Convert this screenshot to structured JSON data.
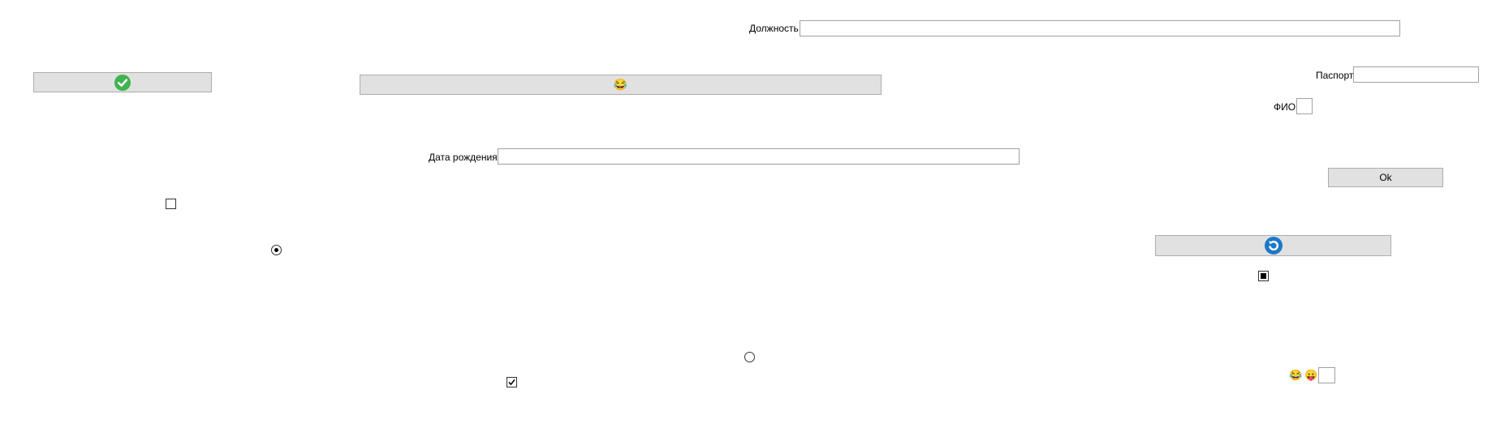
{
  "labels": {
    "dolzhnost": "Должность",
    "pasport": "Паспорт",
    "fio": "ФИО",
    "data_rozhdeniya": "Дата рождения"
  },
  "buttons": {
    "ok_label": "Ok",
    "emoji_button_glyph": "😂"
  },
  "inline_emojis": {
    "first": "😂",
    "second": "😛"
  },
  "fields": {
    "dolzhnost_value": "",
    "pasport_value": "",
    "fio_value": "",
    "data_rozhdeniya_value": "",
    "small_box_value": ""
  },
  "checkboxes": {
    "left_checked": false,
    "bottom_checked": true,
    "right_state": "indeterminate"
  },
  "radios": {
    "left_selected": true,
    "center_selected": false
  },
  "colors": {
    "check_circle": "#3fb34f",
    "refresh_circle": "#1e78c8",
    "button_bg": "#e1e1e1"
  }
}
